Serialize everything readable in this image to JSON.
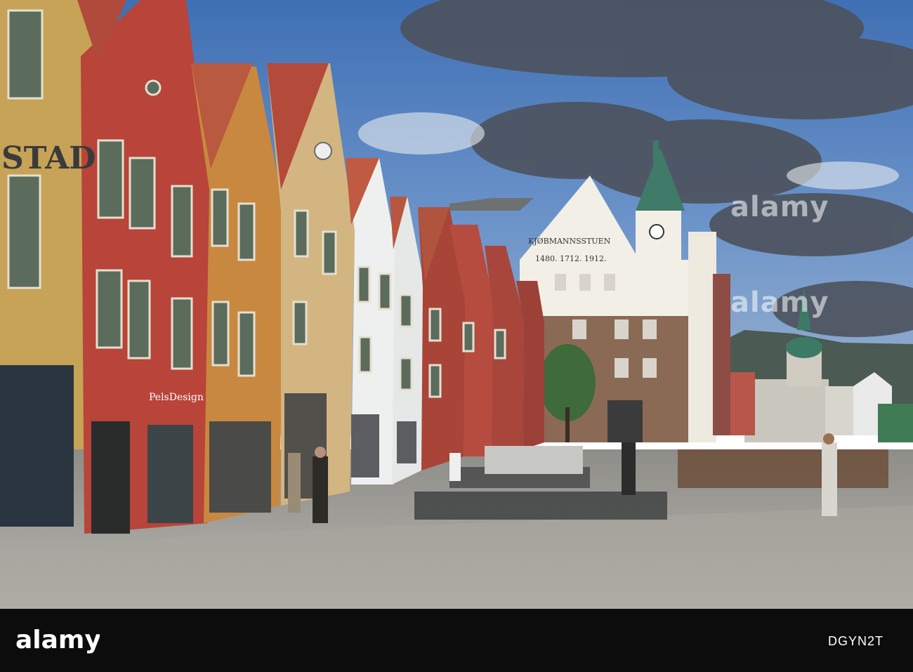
{
  "photo": {
    "description_colors": {
      "sky": "#5a86c4",
      "cloud": "#4a4e58",
      "cobble": "#8f8f8d"
    },
    "signs": {
      "stad": "STAD",
      "pelsdesign": "PelsDesign",
      "kontor": "KJØBMANNSSTUEN",
      "years": "1480. 1712. 1912."
    }
  },
  "watermark": {
    "text": "alamy"
  },
  "footer": {
    "logo": "alamy",
    "image_id": "DGYN2T"
  }
}
